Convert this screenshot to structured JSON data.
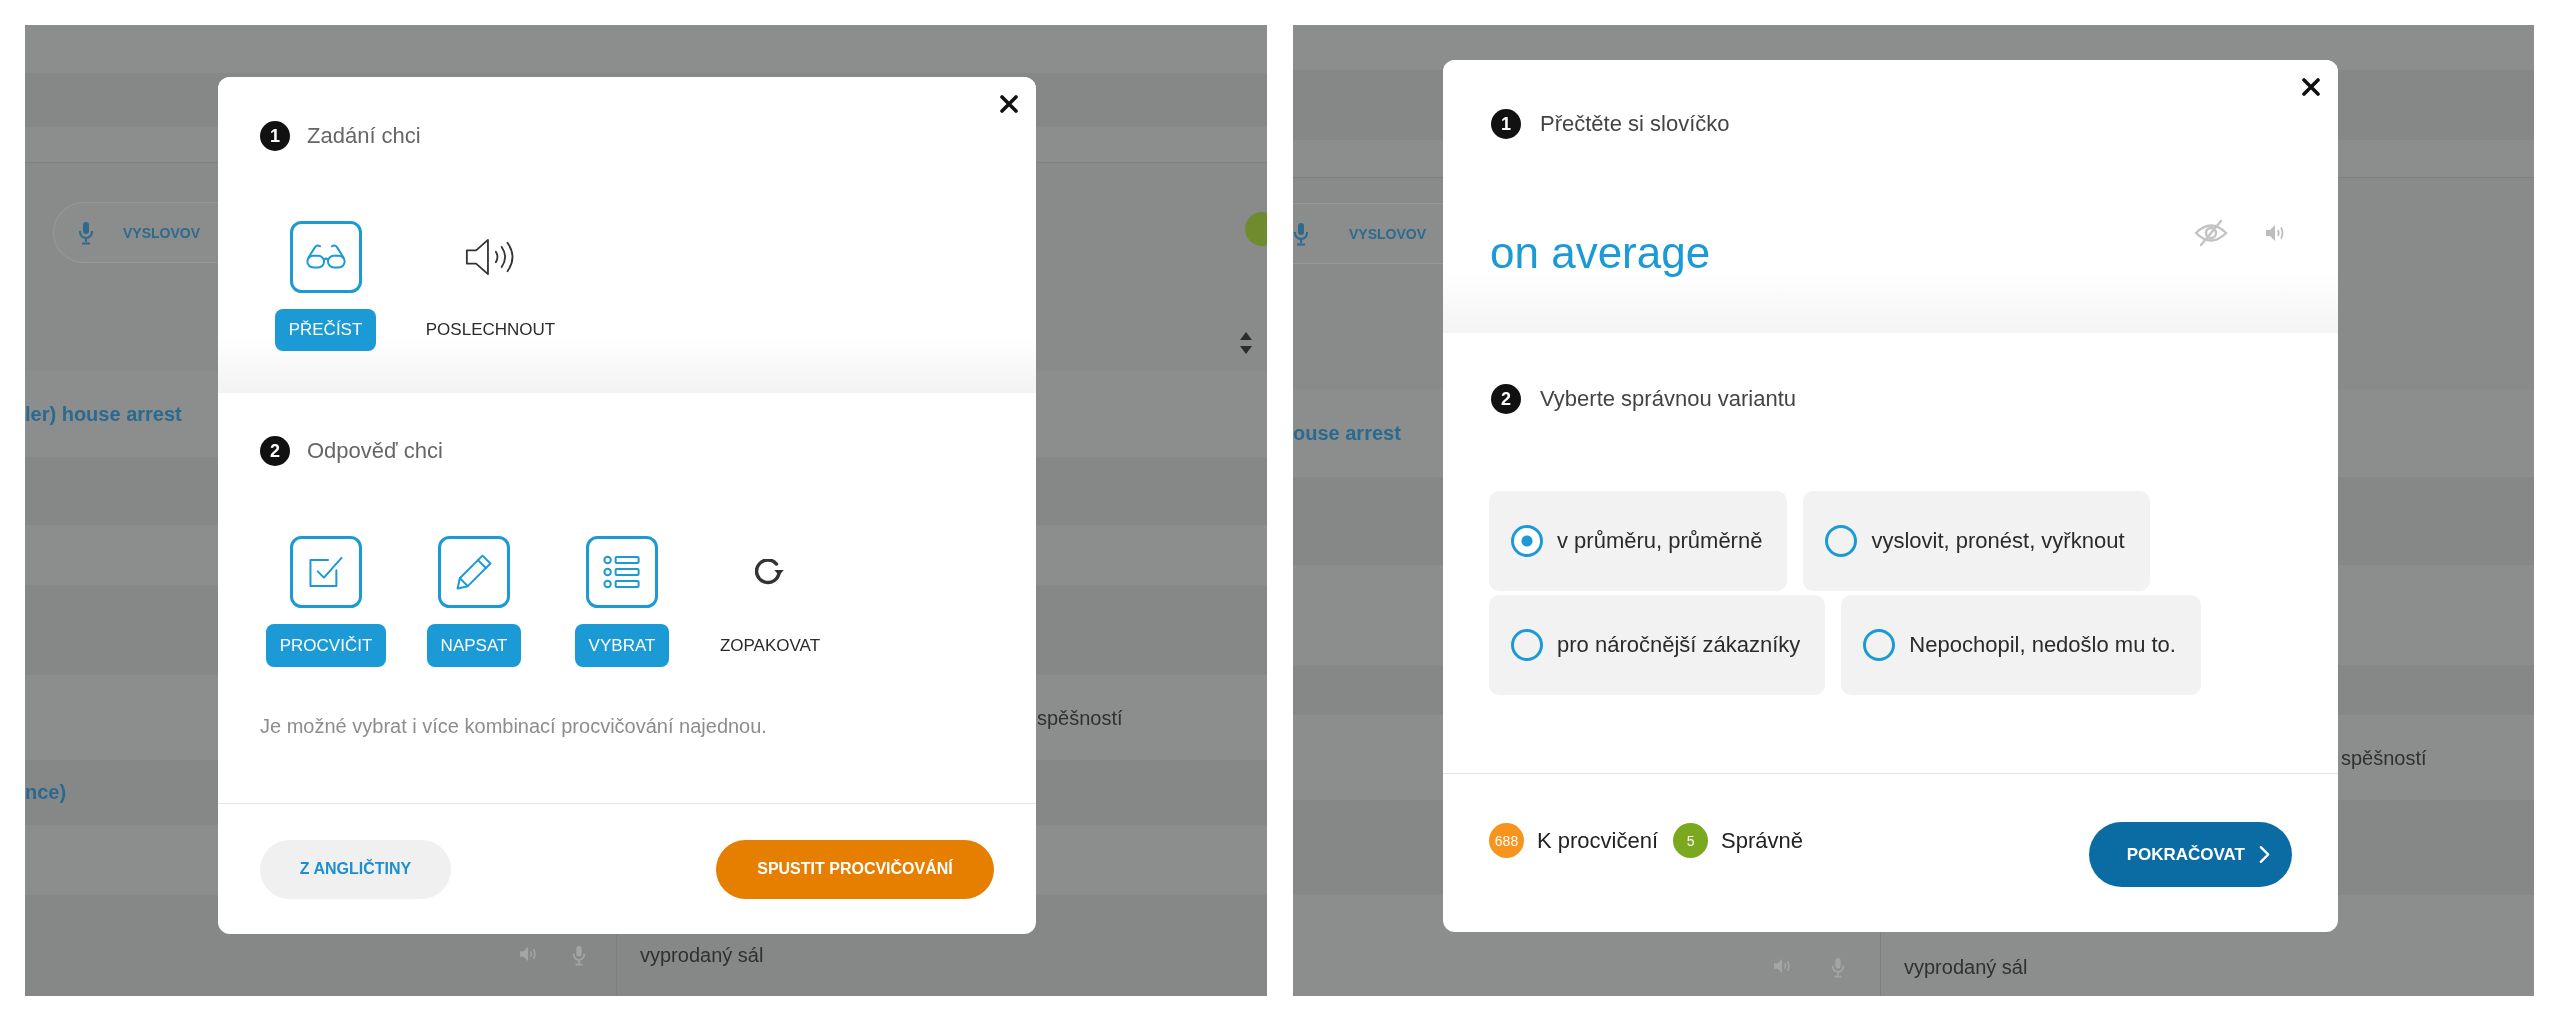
{
  "setup_screen": {
    "background": {
      "pronounce_button": "VYSLOVOV",
      "phrase": "ler) house arrest",
      "column_text": "spěšností",
      "phrase_2": "nce)",
      "row_text": "vyprodaný sál"
    },
    "dialog": {
      "steps": [
        {
          "number": "1",
          "title": "Zadání chci",
          "options": [
            {
              "label": "PŘEČÍST",
              "selected": true
            },
            {
              "label": "POSLECHNOUT",
              "selected": false
            }
          ]
        },
        {
          "number": "2",
          "title": "Odpověď chci",
          "options": [
            {
              "label": "PROCVIČIT",
              "selected": true
            },
            {
              "label": "NAPSAT",
              "selected": true
            },
            {
              "label": "VYBRAT",
              "selected": true
            },
            {
              "label": "ZOPAKOVAT",
              "selected": false
            }
          ]
        }
      ],
      "hint": "Je možné vybrat i více kombinací procvičování najednou.",
      "direction_button": "Z ANGLIČTINY",
      "start_button": "SPUSTIT PROCVIČOVÁNÍ"
    }
  },
  "quiz_screen": {
    "background": {
      "pronounce_button": "VYSLOVOV",
      "phrase": "ouse arrest",
      "column_text": "spěšností",
      "row_text": "vyprodaný sál"
    },
    "dialog": {
      "step_1": {
        "number": "1",
        "title": "Přečtěte si slovíčko"
      },
      "word": "on average",
      "step_2": {
        "number": "2",
        "title": "Vyberte správnou variantu"
      },
      "answers": [
        {
          "text": "v průměru, průměrně",
          "selected": true
        },
        {
          "text": "vyslovit, pronést, vyřknout",
          "selected": false
        },
        {
          "text": "pro náročnější zákazníky",
          "selected": false
        },
        {
          "text": "Nepochopil, nedošlo mu to.",
          "selected": false
        }
      ],
      "counters": [
        {
          "count": "688",
          "label": "K procvičení",
          "color": "#f7941d"
        },
        {
          "count": "5",
          "label": "Správně",
          "color": "#7aa81e"
        }
      ],
      "continue_button": "POKRAČOVAT"
    }
  }
}
